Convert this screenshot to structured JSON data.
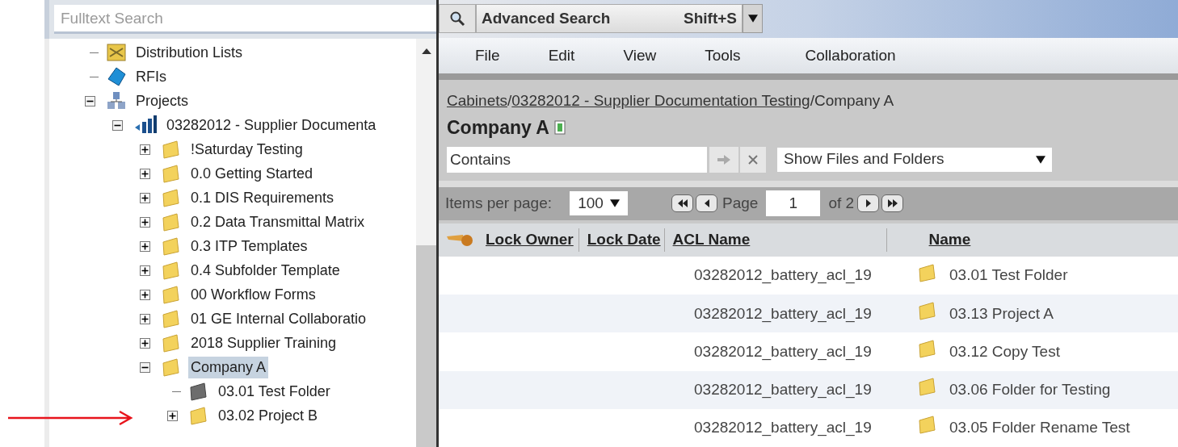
{
  "search": {
    "placeholder": "Fulltext Search"
  },
  "advanced_search": {
    "label": "Advanced Search",
    "shortcut": "Shift+S"
  },
  "tree": [
    {
      "label": "Distribution Lists",
      "kind": "distribution",
      "expandable": false,
      "selected": false
    },
    {
      "label": "RFIs",
      "kind": "rfi",
      "expandable": false,
      "selected": false
    },
    {
      "label": "Projects",
      "kind": "projects",
      "expandable": true,
      "expanded": true,
      "selected": false,
      "children": [
        {
          "label": "03282012 - Supplier Documenta",
          "kind": "project",
          "expandable": true,
          "expanded": true,
          "selected": false,
          "children": [
            {
              "label": "!Saturday Testing",
              "kind": "folder",
              "expandable": true,
              "expanded": false,
              "selected": false
            },
            {
              "label": "0.0 Getting Started",
              "kind": "folder",
              "expandable": true,
              "expanded": false,
              "selected": false
            },
            {
              "label": "0.1 DIS Requirements",
              "kind": "folder",
              "expandable": true,
              "expanded": false,
              "selected": false
            },
            {
              "label": "0.2 Data Transmittal Matrix",
              "kind": "folder",
              "expandable": true,
              "expanded": false,
              "selected": false
            },
            {
              "label": "0.3 ITP Templates",
              "kind": "folder",
              "expandable": true,
              "expanded": false,
              "selected": false
            },
            {
              "label": "0.4 Subfolder Template",
              "kind": "folder",
              "expandable": true,
              "expanded": false,
              "selected": false
            },
            {
              "label": "00 Workflow Forms",
              "kind": "folder",
              "expandable": true,
              "expanded": false,
              "selected": false
            },
            {
              "label": "01 GE Internal Collaboratio",
              "kind": "folder",
              "expandable": true,
              "expanded": false,
              "selected": false
            },
            {
              "label": "2018 Supplier Training",
              "kind": "folder",
              "expandable": true,
              "expanded": false,
              "selected": false
            },
            {
              "label": "Company A",
              "kind": "folder",
              "expandable": true,
              "expanded": true,
              "selected": true,
              "children": [
                {
                  "label": "03.01 Test Folder",
                  "kind": "grey-folder",
                  "expandable": false,
                  "selected": false
                },
                {
                  "label": "03.02 Project B",
                  "kind": "folder",
                  "expandable": true,
                  "expanded": false,
                  "selected": false
                }
              ]
            }
          ]
        }
      ]
    }
  ],
  "menu": [
    "File",
    "Edit",
    "View",
    "Tools",
    "Collaboration"
  ],
  "breadcrumb": {
    "separator": "/",
    "items": [
      {
        "label": "Cabinets",
        "link": true
      },
      {
        "label": "03282012 - Supplier Documentation Testing",
        "link": true
      },
      {
        "label": "Company A",
        "link": false
      }
    ]
  },
  "folder_title": "Company A",
  "filter": {
    "value": "Contains",
    "view_select": "Show Files and Folders"
  },
  "pagination": {
    "items_label": "Items per page:",
    "items_value": "100",
    "page_label": "Page",
    "page_value": "1",
    "of_label": "of 2"
  },
  "table": {
    "columns": [
      "Lock Owner",
      "Lock Date",
      "ACL Name",
      "Name"
    ],
    "rows": [
      {
        "acl": "03282012_battery_acl_19",
        "name": "03.01 Test Folder"
      },
      {
        "acl": "03282012_battery_acl_19",
        "name": "03.13 Project A"
      },
      {
        "acl": "03282012_battery_acl_19",
        "name": "03.12 Copy Test"
      },
      {
        "acl": "03282012_battery_acl_19",
        "name": "03.06 Folder for Testing"
      },
      {
        "acl": "03282012_battery_acl_19",
        "name": "03.05 Folder Rename Test"
      }
    ]
  }
}
